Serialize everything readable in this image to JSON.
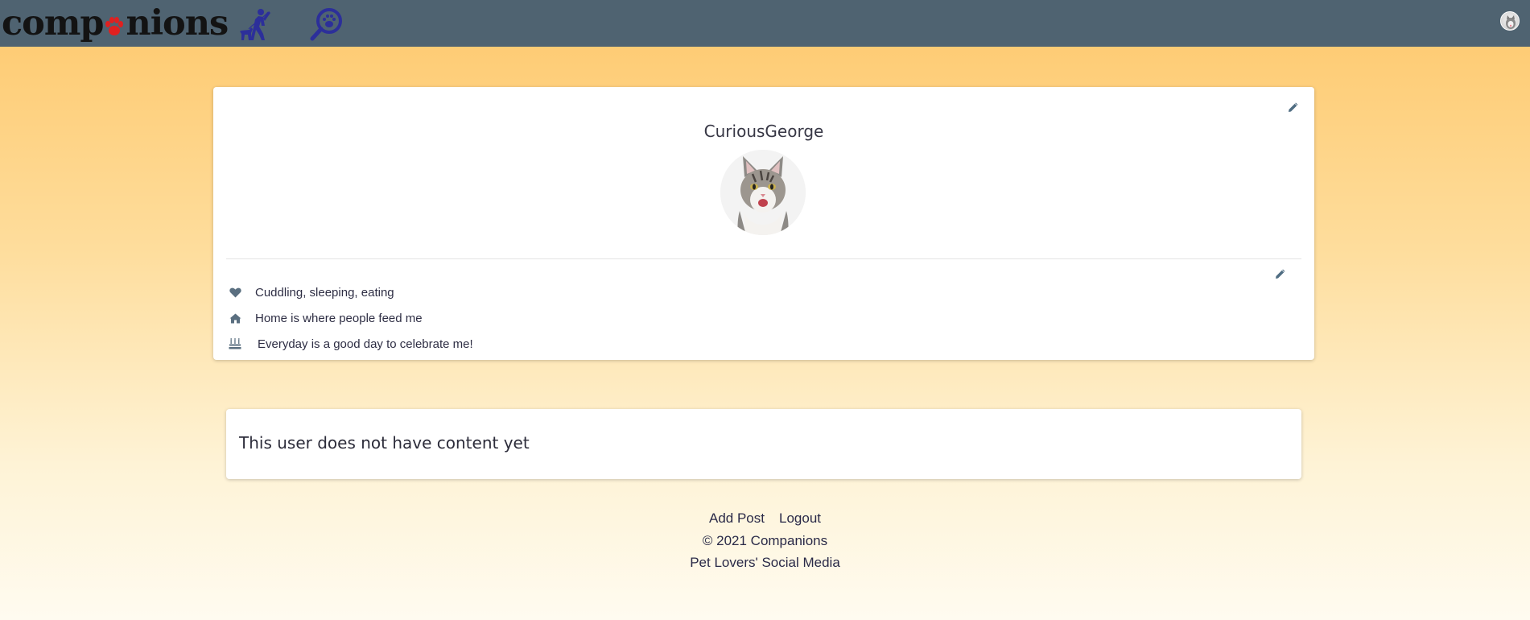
{
  "navbar": {
    "brand_prefix": "comp",
    "brand_suffix": "nions",
    "icons": [
      "dog-walk-icon",
      "paw-search-icon",
      "user-avatar-icon"
    ],
    "background_color": "#4f6371",
    "icon_color": "#2c2f9a",
    "paw_color": "#e02020"
  },
  "profile": {
    "username": "CuriousGeorge",
    "avatar_icon": "cat-avatar",
    "info": {
      "hobbies": "Cuddling, sleeping, eating",
      "home": "Home is where people feed me",
      "birthday": "Everyday is a good day to celebrate me!"
    }
  },
  "content": {
    "empty_message": "This user does not have content yet"
  },
  "footer": {
    "add_post": "Add Post",
    "logout": "Logout",
    "copyright": "© 2021 Companions",
    "tagline": "Pet Lovers' Social Media"
  }
}
